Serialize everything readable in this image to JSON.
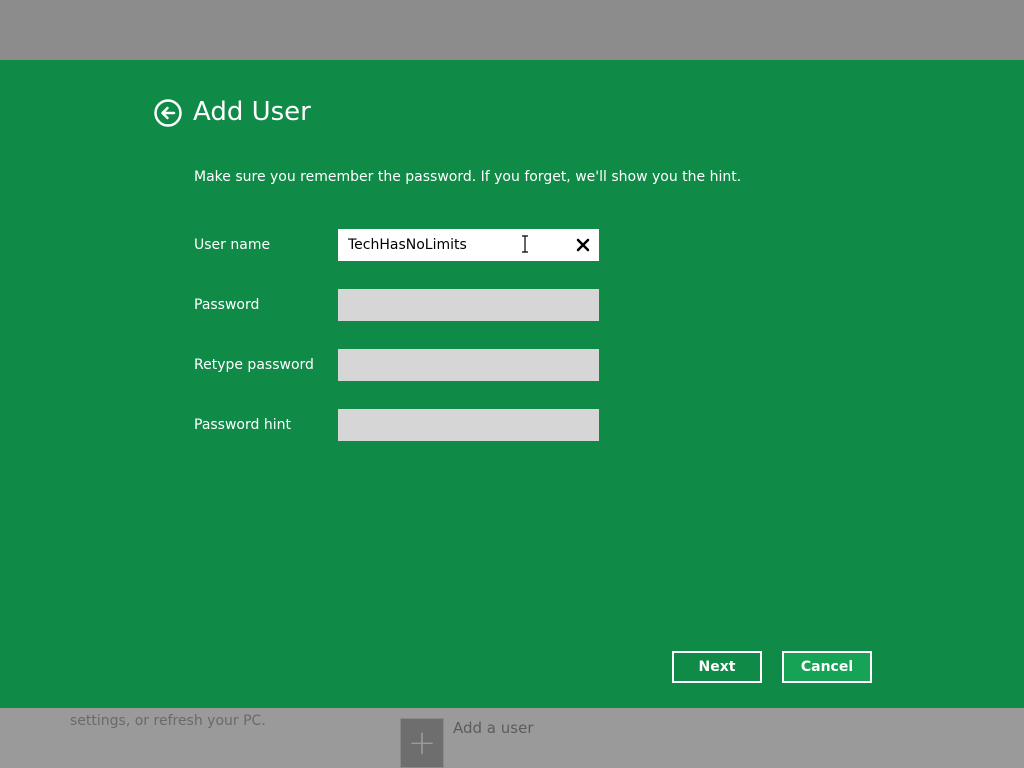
{
  "background": {
    "description_text": "settings, or refresh your PC.",
    "add_user_label": "Add a user",
    "add_user_icon": "plus-icon"
  },
  "dialog": {
    "title": "Add User",
    "back_icon": "back-arrow-icon",
    "subtitle": "Make sure you remember the password. If you forget, we'll show you the hint.",
    "accent_color": "#0f8a47",
    "fields": {
      "username": {
        "label": "User name",
        "value": "TechHasNoLimits"
      },
      "password": {
        "label": "Password",
        "value": ""
      },
      "retype": {
        "label": "Retype password",
        "value": ""
      },
      "hint": {
        "label": "Password hint",
        "value": ""
      }
    },
    "clear_icon": "close-icon",
    "buttons": {
      "next": "Next",
      "cancel": "Cancel"
    }
  }
}
